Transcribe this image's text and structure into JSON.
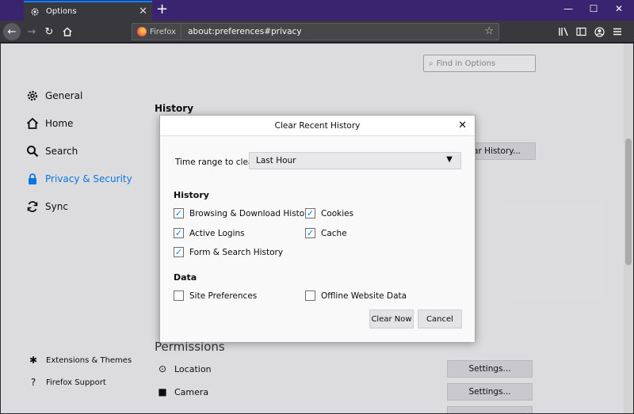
{
  "browser": {
    "tab_title": "Options",
    "tab_close_icon": "close-icon",
    "new_tab_icon": "plus-icon",
    "window_controls": [
      "—",
      "☐",
      "✕"
    ],
    "identity_label": "Firefox",
    "url": "about:preferences#privacy"
  },
  "prefs": {
    "find_placeholder": "Find in Options",
    "categories": [
      {
        "label": "General",
        "icon": "gear-icon"
      },
      {
        "label": "Home",
        "icon": "home-icon"
      },
      {
        "label": "Search",
        "icon": "search-icon"
      },
      {
        "label": "Privacy & Security",
        "icon": "lock-icon"
      },
      {
        "label": "Sync",
        "icon": "sync-icon"
      }
    ],
    "footer": [
      {
        "label": "Extensions & Themes",
        "icon": "puzzle-icon"
      },
      {
        "label": "Firefox Support",
        "icon": "help-icon"
      }
    ],
    "history_heading": "History",
    "clear_history_button": "ear History...",
    "permissions_heading": "Permissions",
    "permissions": [
      {
        "label": "Location",
        "icon": "location-icon",
        "button": "Settings..."
      },
      {
        "label": "Camera",
        "icon": "camera-icon",
        "button": "Settings..."
      }
    ]
  },
  "dialog": {
    "title": "Clear Recent History",
    "time_range_label": "Time range to clear:",
    "time_range_value": "Last Hour",
    "history_heading": "History",
    "history_items": [
      {
        "label": "Browsing & Download History",
        "checked": true
      },
      {
        "label": "Cookies",
        "checked": true
      },
      {
        "label": "Active Logins",
        "checked": true
      },
      {
        "label": "Cache",
        "checked": true
      },
      {
        "label": "Form & Search History",
        "checked": true
      }
    ],
    "data_heading": "Data",
    "data_items": [
      {
        "label": "Site Preferences",
        "checked": false
      },
      {
        "label": "Offline Website Data",
        "checked": false
      }
    ],
    "clear_now": "Clear Now",
    "cancel": "Cancel"
  },
  "colors": {
    "accent": "#0a84ff",
    "titlebar": "#3a2470",
    "toolbar": "#38383d"
  }
}
